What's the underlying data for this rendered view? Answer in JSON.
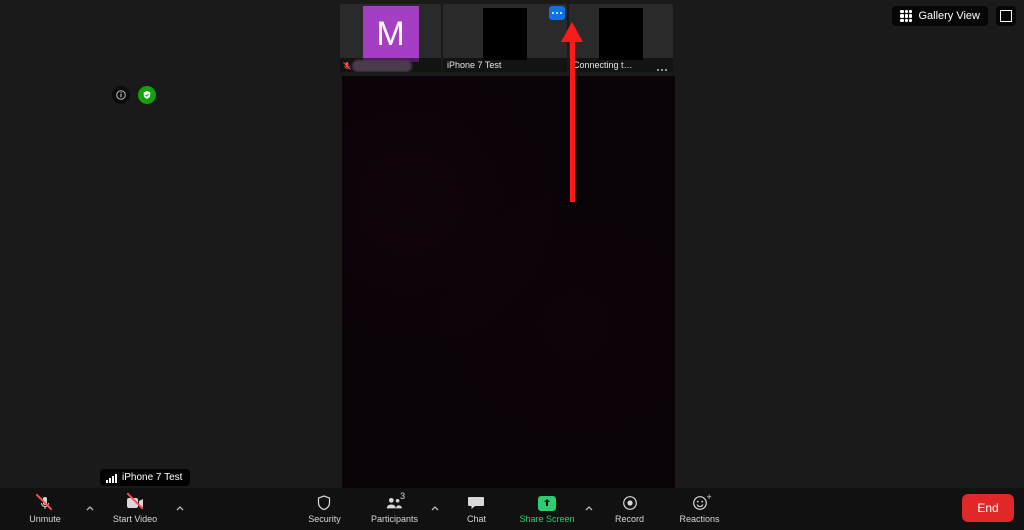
{
  "view_switch": {
    "label": "Gallery View"
  },
  "participants_strip": [
    {
      "name": "",
      "avatar_letter": "M",
      "muted": true
    },
    {
      "name": "iPhone 7 Test"
    },
    {
      "name": "Connecting t…"
    }
  ],
  "device_tooltip": {
    "label": "iPhone 7 Test"
  },
  "toolbar": {
    "unmute": "Unmute",
    "start_video": "Start Video",
    "security": "Security",
    "participants": "Participants",
    "participants_count": "3",
    "chat": "Chat",
    "share_screen": "Share Screen",
    "record": "Record",
    "reactions": "Reactions",
    "end": "End"
  }
}
